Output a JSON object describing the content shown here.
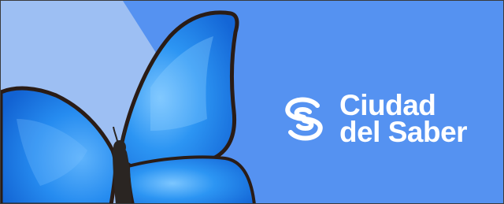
{
  "banner": {
    "brand_line_1": "Ciudad",
    "brand_line_2": "del Saber",
    "logo_icon": "ciudad-del-saber-s-logo-icon",
    "image_subject": "blue-morpho-butterfly",
    "colors": {
      "background": "#5592f1",
      "light_panel": "#9dbff3",
      "wing_blue": "#1e86ef",
      "wing_highlight": "#6ab8fb",
      "wing_edge": "#2a1c16",
      "body": "#2a2522",
      "text": "#ffffff"
    }
  }
}
